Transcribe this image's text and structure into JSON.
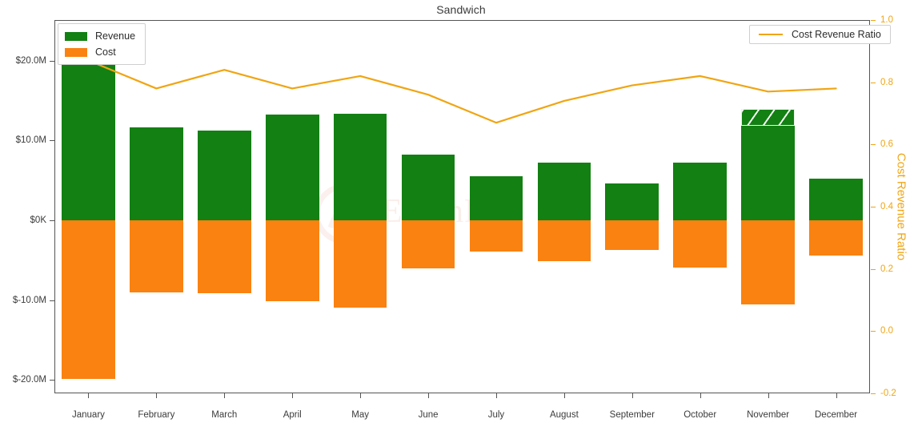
{
  "chart_data": {
    "type": "bar",
    "title": "Sandwich",
    "xlabel": "",
    "ylabel": "",
    "y2label": "Cost Revenue Ratio",
    "grid": false,
    "legend_position": [
      "upper-left",
      "upper-right"
    ],
    "categories": [
      "January",
      "February",
      "March",
      "April",
      "May",
      "June",
      "July",
      "August",
      "September",
      "October",
      "November",
      "December"
    ],
    "series": [
      {
        "name": "Revenue",
        "type": "bar",
        "axis": "left",
        "color": "#128012",
        "values": [
          23.3,
          11.6,
          11.2,
          13.2,
          13.4,
          8.2,
          5.5,
          7.2,
          4.6,
          7.2,
          14.0,
          5.2
        ],
        "units": "millions USD"
      },
      {
        "name": "Cost",
        "type": "bar",
        "axis": "left",
        "color": "#fa8211",
        "values": [
          -19.9,
          -9.0,
          -9.1,
          -10.2,
          -11.0,
          -6.0,
          -3.9,
          -5.1,
          -3.7,
          -5.9,
          -10.6,
          -4.4
        ],
        "units": "millions USD"
      },
      {
        "name": "Cost Revenue Ratio",
        "type": "line",
        "axis": "right",
        "color": "#f0a513",
        "values": [
          0.87,
          0.78,
          0.84,
          0.78,
          0.82,
          0.76,
          0.67,
          0.74,
          0.79,
          0.82,
          0.77,
          0.78
        ]
      }
    ],
    "y_left": {
      "ticks": [
        20000000,
        10000000,
        0,
        -10000000,
        -20000000
      ],
      "tick_labels": [
        "$20.0M",
        "$10.0M",
        "$0K",
        "$-10.0M",
        "$-20.0M"
      ],
      "ylim": [
        -21700000,
        25100000
      ]
    },
    "y_right": {
      "ticks": [
        1.0,
        0.8,
        0.6,
        0.4,
        0.2,
        0.0,
        -0.2
      ],
      "tick_labels": [
        "1.0",
        "0.8",
        "0.6",
        "0.4",
        "0.2",
        "0.0",
        "-0.2"
      ],
      "ylim": [
        -0.2,
        1.0
      ]
    },
    "annotations": [
      {
        "kind": "hatched-bar-segment",
        "category": "November",
        "series": "Revenue",
        "note": "top portion of November Revenue bar drawn with diagonal hatch pattern"
      }
    ]
  },
  "legend_left": {
    "items": [
      {
        "label": "Revenue",
        "color": "#128012"
      },
      {
        "label": "Cost",
        "color": "#fa8211"
      }
    ]
  },
  "legend_right": {
    "items": [
      {
        "label": "Cost Revenue Ratio",
        "color": "#f0a513"
      }
    ]
  },
  "watermark": {
    "text": "EigenPhi"
  },
  "colors": {
    "revenue": "#128012",
    "cost": "#fa8211",
    "ratio": "#f0a513",
    "axis": "#555555",
    "text": "#3b3b3b",
    "background": "#ffffff"
  }
}
